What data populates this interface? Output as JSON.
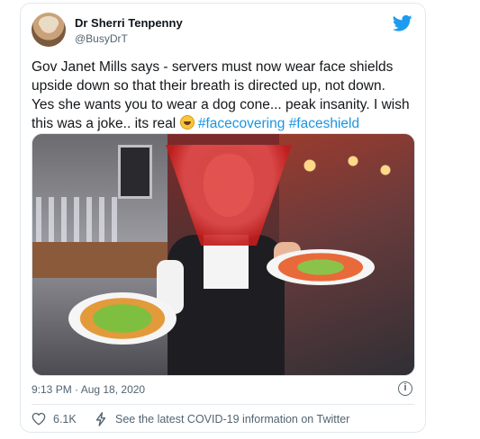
{
  "tweet": {
    "author": {
      "name": "Dr Sherri Tenpenny",
      "handle": "@BusyDrT"
    },
    "text_lines": [
      "Gov Janet Mills says - servers must now wear face shields",
      "upside down so that their breath is directed up, not down.",
      "Yes she wants you to wear a dog cone... peak insanity.  I wish",
      "this was a joke.. its real"
    ],
    "hashtags": [
      "#facecovering",
      "#faceshield"
    ],
    "timestamp": "9:13 PM · Aug 18, 2020",
    "likes": "6.1K",
    "covid_notice": "See the latest COVID-19 information on Twitter",
    "info_glyph": "i"
  },
  "colors": {
    "accent": "#1b95e0",
    "muted": "#536471",
    "border": "#e1e8ed"
  }
}
